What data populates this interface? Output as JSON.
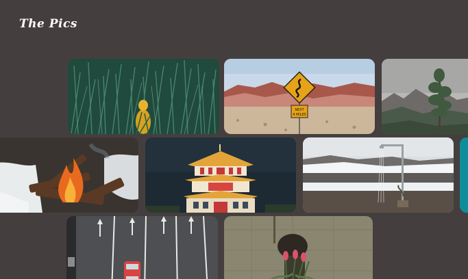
{
  "header": {
    "logo_text": "The Pics"
  },
  "gallery": {
    "photos": [
      {
        "subject": "person-in-yellow-coat-in-tall-grass"
      },
      {
        "subject": "winding-road-sign-in-desert",
        "sign_text_line1": "NEXT",
        "sign_text_line2": "4 MILES"
      },
      {
        "subject": "lone-tree-on-mountain"
      },
      {
        "subject": "campfire-in-snow"
      },
      {
        "subject": "chinese-pagoda-at-night"
      },
      {
        "subject": "outdoor-shower-in-snowy-landscape"
      },
      {
        "subject": "teal-partial-tile"
      },
      {
        "subject": "aerial-road-with-car"
      },
      {
        "subject": "person-holding-tulips"
      }
    ]
  },
  "colors": {
    "background": "#443f3e",
    "logo": "#ffffff"
  }
}
